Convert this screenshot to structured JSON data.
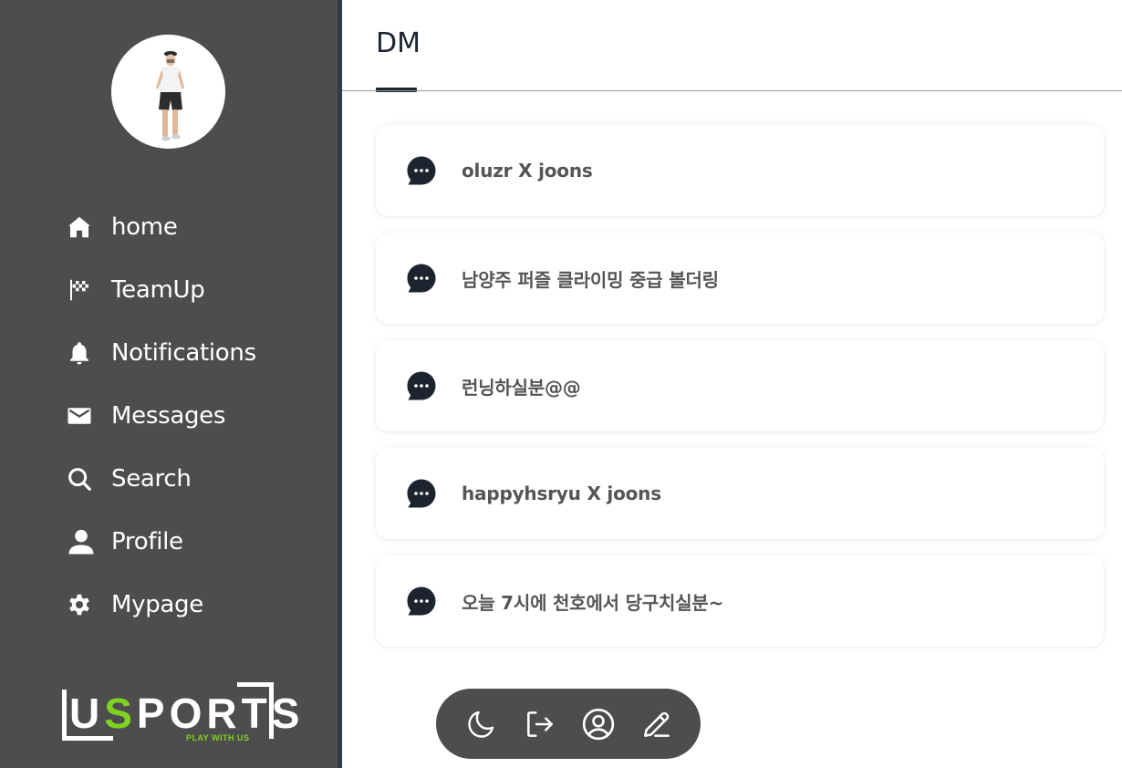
{
  "sidebar": {
    "items": [
      {
        "label": "home",
        "icon": "home-icon"
      },
      {
        "label": "TeamUp",
        "icon": "checkered-flag-icon"
      },
      {
        "label": "Notifications",
        "icon": "bell-icon"
      },
      {
        "label": "Messages",
        "icon": "envelope-icon"
      },
      {
        "label": "Search",
        "icon": "search-icon"
      },
      {
        "label": "Profile",
        "icon": "user-icon"
      },
      {
        "label": "Mypage",
        "icon": "gear-icon"
      }
    ],
    "logo": {
      "text_before": "U",
      "text_accent": "S",
      "text_after": "PORTS",
      "tagline": "PLAY WITH US"
    }
  },
  "header": {
    "tab": "DM"
  },
  "conversations": [
    {
      "title": "oluzr X joons",
      "icon": "chat-bubble-icon"
    },
    {
      "title": "남양주 퍼즐 클라이밍 중급 볼더링",
      "icon": "chat-bubble-icon"
    },
    {
      "title": "런닝하실분@@",
      "icon": "chat-bubble-icon"
    },
    {
      "title": "happyhsryu X joons",
      "icon": "chat-bubble-icon"
    },
    {
      "title": "오늘 7시에 천호에서 당구치실분~",
      "icon": "chat-bubble-icon"
    }
  ],
  "toolbar": {
    "buttons": [
      "moon-icon",
      "logout-icon",
      "account-circle-icon",
      "pencil-icon"
    ]
  },
  "colors": {
    "sidebar_bg": "#4d4d4d",
    "accent_green": "#7ed321",
    "dark_navy": "#1d2430",
    "card_text": "#555555"
  }
}
